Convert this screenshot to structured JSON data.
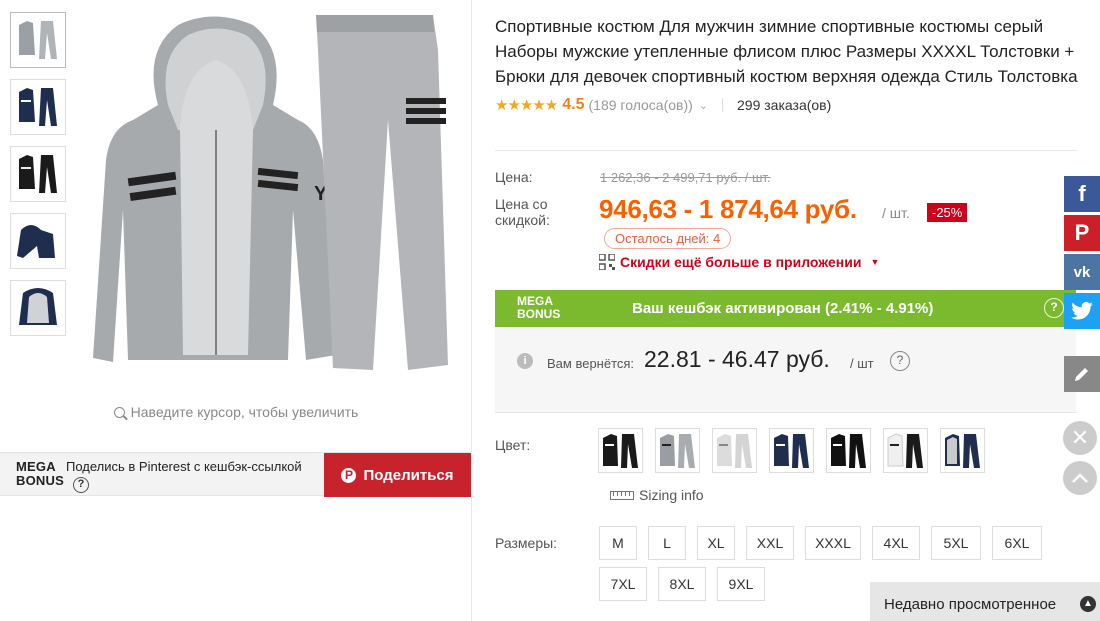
{
  "product": {
    "title": "Спортивные костюм Для мужчин зимние спортивные костюмы серый Наборы мужские утепленные флисом плюс Размеры XXXXL Толстовки + Брюки для девочек спортивный костюм верхняя одежда Стиль Толстовка",
    "stars": "★★★★★",
    "rating": "4.5",
    "votes": "(189 голоса(ов))",
    "orders": "299 заказа(ов)"
  },
  "gallery": {
    "zoom_hint": "Наведите курсор, чтобы увеличить",
    "thumbnails": [
      "gray-set",
      "navy-set",
      "black-set",
      "navy-hoodie",
      "lined-hoodie"
    ]
  },
  "share": {
    "logo_line1": "MEGA",
    "logo_line2": "BONUS",
    "text": "Поделись в Pinterest с кешбэк-ссылкой",
    "help": "?",
    "button_label": "Поделиться",
    "button_icon": "P"
  },
  "price": {
    "label": "Цена:",
    "old": "1 262,36 - 2 499,71 руб. / шт.",
    "discount_label_1": "Цена со",
    "discount_label_2": "скидкой:",
    "new": "946,63 - 1 874,64 руб.",
    "per_unit": "/ шт.",
    "discount": "-25%",
    "days_left": "Осталось дней: 4",
    "app_deal": "Скидки ещё больше в приложении"
  },
  "megabonus": {
    "logo_line1": "MEGA",
    "logo_line2": "BONUS",
    "text": "Ваш кешбэк активирован (2.41% - 4.91%)",
    "help": "?",
    "info_icon": "i",
    "cashback_label": "Вам вернётся:",
    "cashback_value": "22.81 - 46.47 руб.",
    "cashback_unit": "/ шт",
    "cashback_help": "?"
  },
  "options": {
    "color_label": "Цвет:",
    "colors": [
      "black-white",
      "gray-black",
      "white-gray",
      "navy-white",
      "black-white-2",
      "white-black",
      "navy-gray"
    ],
    "sizing_info": "Sizing info",
    "size_label": "Размеры:",
    "sizes": [
      "M",
      "L",
      "XL",
      "XXL",
      "XXXL",
      "4XL",
      "5XL",
      "6XL",
      "7XL",
      "8XL",
      "9XL"
    ]
  },
  "social": {
    "facebook": "f",
    "pinterest": "P",
    "vk": "vk",
    "twitter": "twitter-bird",
    "edit": "pencil"
  },
  "recent": {
    "label": "Недавно просмотренное"
  },
  "colors": {
    "price_orange": "#f96100",
    "discount_red": "#d0021b",
    "mega_green": "#7bba2e",
    "pin_red": "#c8232c",
    "facebook": "#3b5998",
    "pinterest": "#cb2027",
    "vk": "#4c75a3",
    "twitter": "#1da1f2"
  }
}
